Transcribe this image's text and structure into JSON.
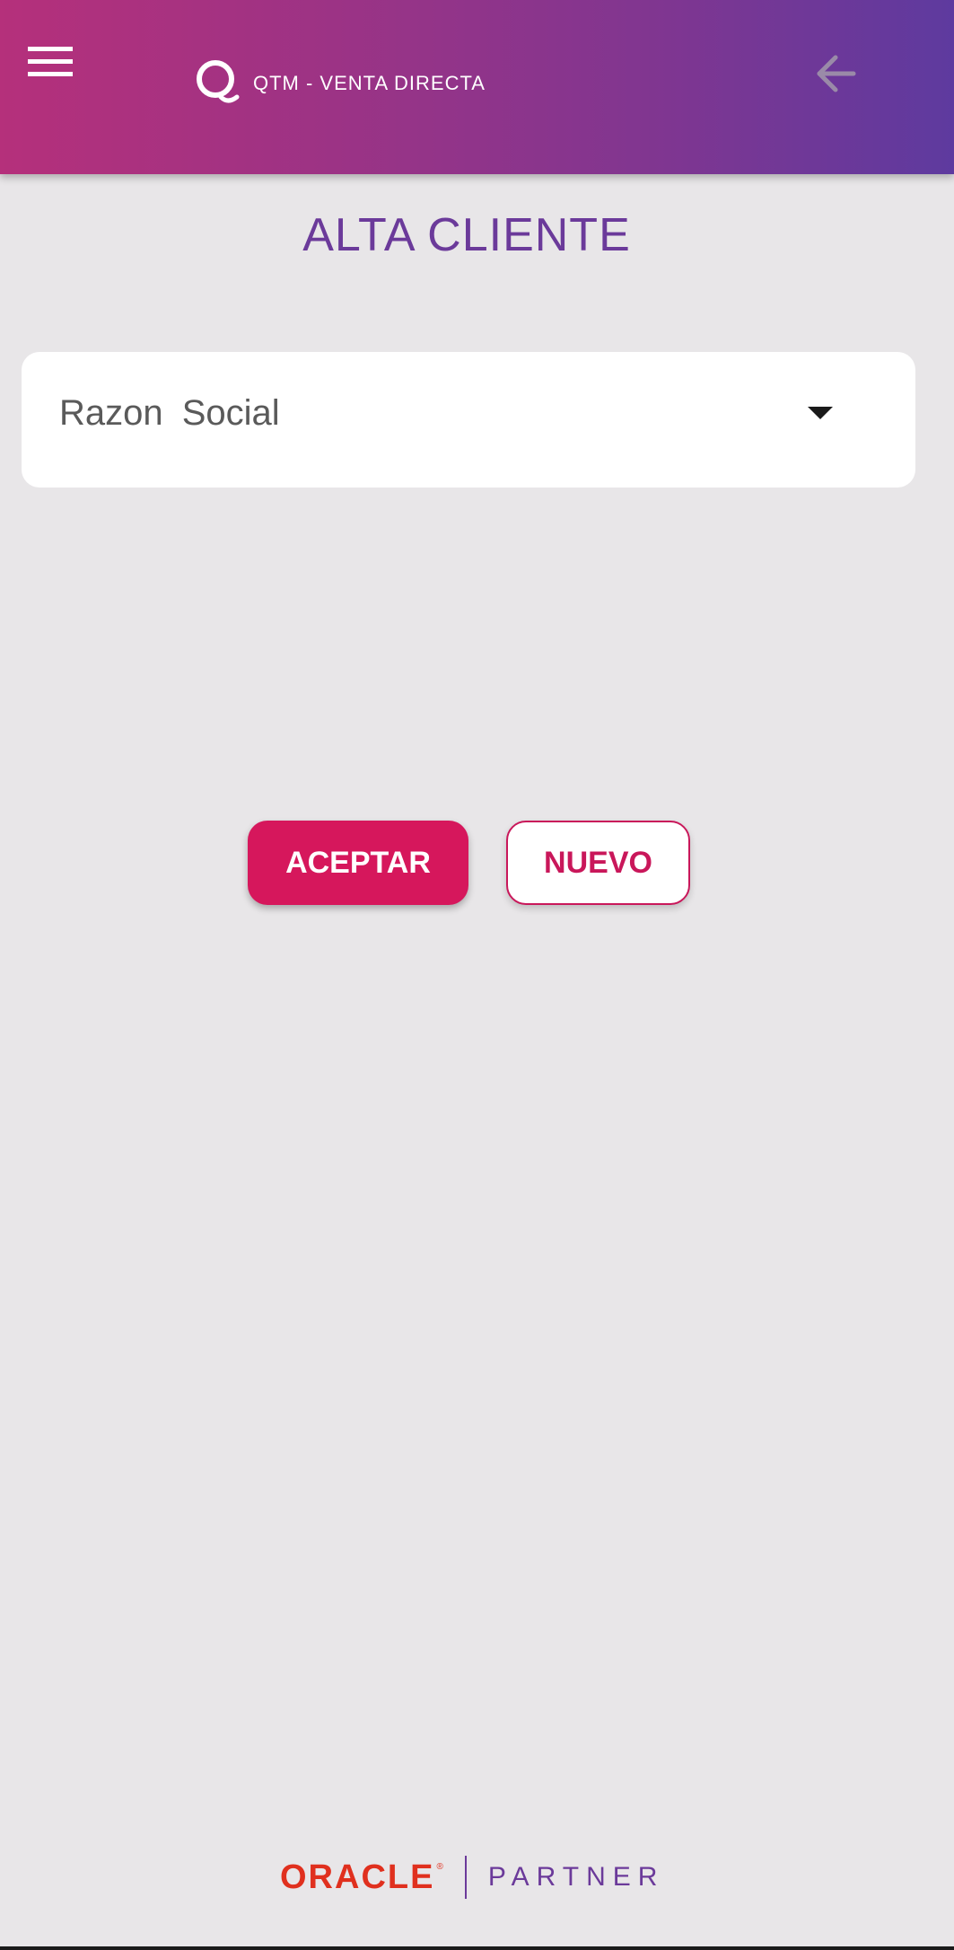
{
  "header": {
    "app_title": "QTM - VENTA DIRECTA",
    "menu_icon": "hamburger-menu-icon",
    "back_icon": "arrow-back-icon",
    "logo_icon": "q-logo-icon",
    "gradient_start": "#b5307b",
    "gradient_end": "#5e3a9f"
  },
  "page": {
    "title": "ALTA CLIENTE"
  },
  "form": {
    "razon_social": {
      "label": "Razon  Social",
      "selected_value": "",
      "dropdown_icon": "dropdown-arrow-icon"
    }
  },
  "actions": {
    "accept_label": "ACEPTAR",
    "new_label": "NUEVO",
    "accent_color": "#d6175c"
  },
  "footer": {
    "oracle_text": "ORACLE",
    "registered_mark": "®",
    "partner_text": "PARTNER"
  }
}
